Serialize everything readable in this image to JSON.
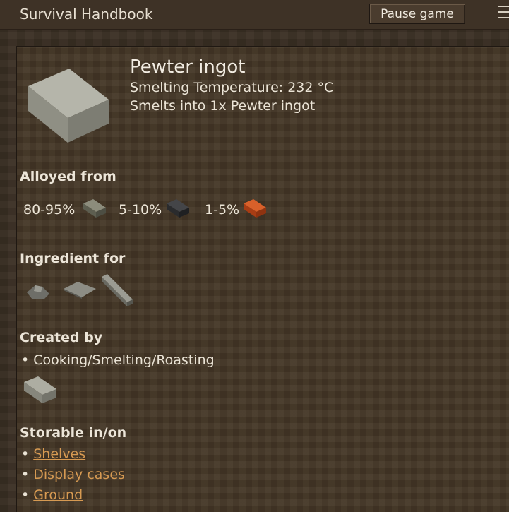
{
  "window": {
    "title": "Survival Handbook",
    "pause_label": "Pause game",
    "menu_icon": "hamburger-menu-icon"
  },
  "item": {
    "name": "Pewter ingot",
    "smelting_temperature": "Smelting Temperature: 232 °C",
    "smelts_into": "Smelts into 1x Pewter ingot",
    "icon": "pewter-ingot-icon"
  },
  "alloyed_from": {
    "heading": "Alloyed from",
    "components": [
      {
        "percent": "80-95%",
        "icon": "tin-ingot-icon",
        "color": "#6f7060"
      },
      {
        "percent": "5-10%",
        "icon": "lead-ingot-icon",
        "color": "#2f3032"
      },
      {
        "percent": "1-5%",
        "icon": "copper-ingot-icon",
        "color": "#c5491a"
      }
    ]
  },
  "ingredient_for": {
    "heading": "Ingredient for",
    "icons": [
      "pewter-lantern-icon",
      "pewter-plate-icon",
      "pewter-bar-icon"
    ]
  },
  "created_by": {
    "heading": "Created by",
    "method": "Cooking/Smelting/Roasting",
    "icon": "pewter-ingot-small-icon"
  },
  "storable": {
    "heading": "Storable in/on",
    "links": [
      "Shelves",
      "Display cases",
      "Ground"
    ]
  },
  "colors": {
    "link": "#d79a52",
    "panel_bg": "#453727",
    "pewter": "#a8a89d"
  }
}
